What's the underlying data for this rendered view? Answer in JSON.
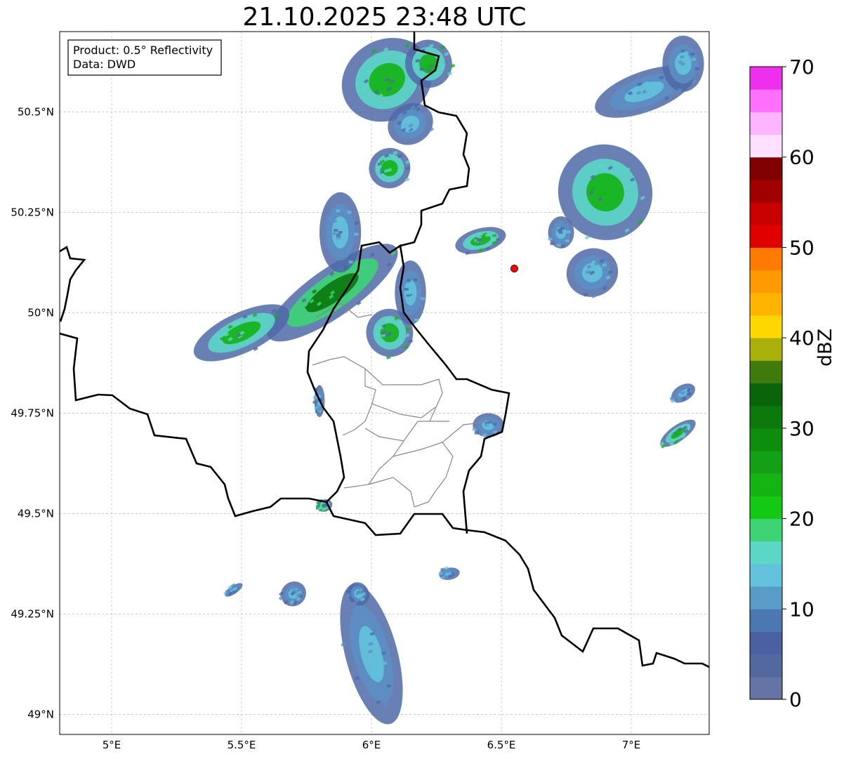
{
  "title": "21.10.2025 23:48 UTC",
  "info_box": {
    "product": "Product: 0.5° Reflectivity",
    "data": "Data: DWD"
  },
  "map": {
    "lon_range": [
      4.8,
      7.3
    ],
    "lat_range": [
      48.95,
      50.7
    ],
    "x_ticks": [
      {
        "value": 5.0,
        "label": "5°E"
      },
      {
        "value": 5.5,
        "label": "5.5°E"
      },
      {
        "value": 6.0,
        "label": "6°E"
      },
      {
        "value": 6.5,
        "label": "6.5°E"
      },
      {
        "value": 7.0,
        "label": "7°E"
      }
    ],
    "y_ticks": [
      {
        "value": 50.5,
        "label": "50.5°N"
      },
      {
        "value": 50.25,
        "label": "50.25°N"
      },
      {
        "value": 50.0,
        "label": "50°N"
      },
      {
        "value": 49.75,
        "label": "49.75°N"
      },
      {
        "value": 49.5,
        "label": "49.5°N"
      },
      {
        "value": 49.25,
        "label": "49.25°N"
      },
      {
        "value": 49.0,
        "label": "49°N"
      }
    ],
    "radar_site": {
      "lon": 6.55,
      "lat": 50.11,
      "color": "#ff0000"
    },
    "grid": true
  },
  "colorbar": {
    "label": "dBZ",
    "min": 0,
    "max": 70,
    "tick_labels": [
      "0",
      "10",
      "20",
      "30",
      "40",
      "50",
      "60",
      "70"
    ],
    "colors": [
      "#6474a4",
      "#5468a0",
      "#4a60a2",
      "#4b78b2",
      "#5a9cc8",
      "#62c2dc",
      "#5cd6c6",
      "#3cd474",
      "#14c814",
      "#14b414",
      "#14a014",
      "#0e8c0e",
      "#0a780a",
      "#0a640a",
      "#407a0a",
      "#aab00a",
      "#ffd700",
      "#ffb400",
      "#ff9a00",
      "#ff7a00",
      "#e00000",
      "#c80000",
      "#a00000",
      "#800000",
      "#ffe0ff",
      "#ffb4ff",
      "#ff70ff",
      "#ee30ee"
    ]
  },
  "precip_cells": [
    {
      "lon": 6.06,
      "lat": 50.58,
      "rlon": 0.18,
      "rlat": 0.1,
      "angle": -30,
      "intensity": "moderate"
    },
    {
      "lon": 6.22,
      "lat": 50.62,
      "rlon": 0.09,
      "rlat": 0.06,
      "angle": -20,
      "intensity": "moderate"
    },
    {
      "lon": 6.15,
      "lat": 50.47,
      "rlon": 0.09,
      "rlat": 0.05,
      "angle": -30,
      "intensity": "weak"
    },
    {
      "lon": 6.07,
      "lat": 50.36,
      "rlon": 0.08,
      "rlat": 0.05,
      "angle": -20,
      "intensity": "moderate"
    },
    {
      "lon": 5.85,
      "lat": 50.05,
      "rlon": 0.3,
      "rlat": 0.06,
      "angle": -35,
      "intensity": "strong"
    },
    {
      "lon": 5.5,
      "lat": 49.95,
      "rlon": 0.2,
      "rlat": 0.05,
      "angle": -25,
      "intensity": "moderate"
    },
    {
      "lon": 5.88,
      "lat": 50.2,
      "rlon": 0.08,
      "rlat": 0.1,
      "angle": 0,
      "intensity": "weak"
    },
    {
      "lon": 6.07,
      "lat": 49.95,
      "rlon": 0.09,
      "rlat": 0.06,
      "angle": -20,
      "intensity": "moderate"
    },
    {
      "lon": 6.15,
      "lat": 50.05,
      "rlon": 0.06,
      "rlat": 0.08,
      "angle": 0,
      "intensity": "weak"
    },
    {
      "lon": 6.9,
      "lat": 50.3,
      "rlon": 0.18,
      "rlat": 0.12,
      "angle": -30,
      "intensity": "moderate"
    },
    {
      "lon": 7.05,
      "lat": 50.55,
      "rlon": 0.2,
      "rlat": 0.05,
      "angle": -20,
      "intensity": "weak"
    },
    {
      "lon": 7.2,
      "lat": 50.62,
      "rlon": 0.08,
      "rlat": 0.07,
      "angle": 0,
      "intensity": "weak"
    },
    {
      "lon": 6.85,
      "lat": 50.1,
      "rlon": 0.1,
      "rlat": 0.06,
      "angle": -20,
      "intensity": "weak"
    },
    {
      "lon": 6.42,
      "lat": 50.18,
      "rlon": 0.1,
      "rlat": 0.03,
      "angle": -15,
      "intensity": "moderate"
    },
    {
      "lon": 6.73,
      "lat": 50.2,
      "rlon": 0.05,
      "rlat": 0.04,
      "angle": 0,
      "intensity": "weak"
    },
    {
      "lon": 6.45,
      "lat": 49.72,
      "rlon": 0.06,
      "rlat": 0.03,
      "angle": 0,
      "intensity": "weak"
    },
    {
      "lon": 7.18,
      "lat": 49.7,
      "rlon": 0.08,
      "rlat": 0.02,
      "angle": -35,
      "intensity": "moderate"
    },
    {
      "lon": 7.2,
      "lat": 49.8,
      "rlon": 0.05,
      "rlat": 0.02,
      "angle": -30,
      "intensity": "weak"
    },
    {
      "lon": 6.0,
      "lat": 49.15,
      "rlon": 0.1,
      "rlat": 0.18,
      "angle": -15,
      "intensity": "weak"
    },
    {
      "lon": 5.95,
      "lat": 49.3,
      "rlon": 0.04,
      "rlat": 0.03,
      "angle": -30,
      "intensity": "weak"
    },
    {
      "lon": 5.7,
      "lat": 49.3,
      "rlon": 0.05,
      "rlat": 0.03,
      "angle": -40,
      "intensity": "weak"
    },
    {
      "lon": 5.8,
      "lat": 49.78,
      "rlon": 0.02,
      "rlat": 0.04,
      "angle": 0,
      "intensity": "weak"
    },
    {
      "lon": 5.82,
      "lat": 49.52,
      "rlon": 0.03,
      "rlat": 0.015,
      "angle": -20,
      "intensity": "moderate"
    },
    {
      "lon": 6.3,
      "lat": 49.35,
      "rlon": 0.04,
      "rlat": 0.015,
      "angle": -10,
      "intensity": "weak"
    },
    {
      "lon": 5.47,
      "lat": 49.31,
      "rlon": 0.04,
      "rlat": 0.01,
      "angle": -35,
      "intensity": "weak"
    }
  ]
}
